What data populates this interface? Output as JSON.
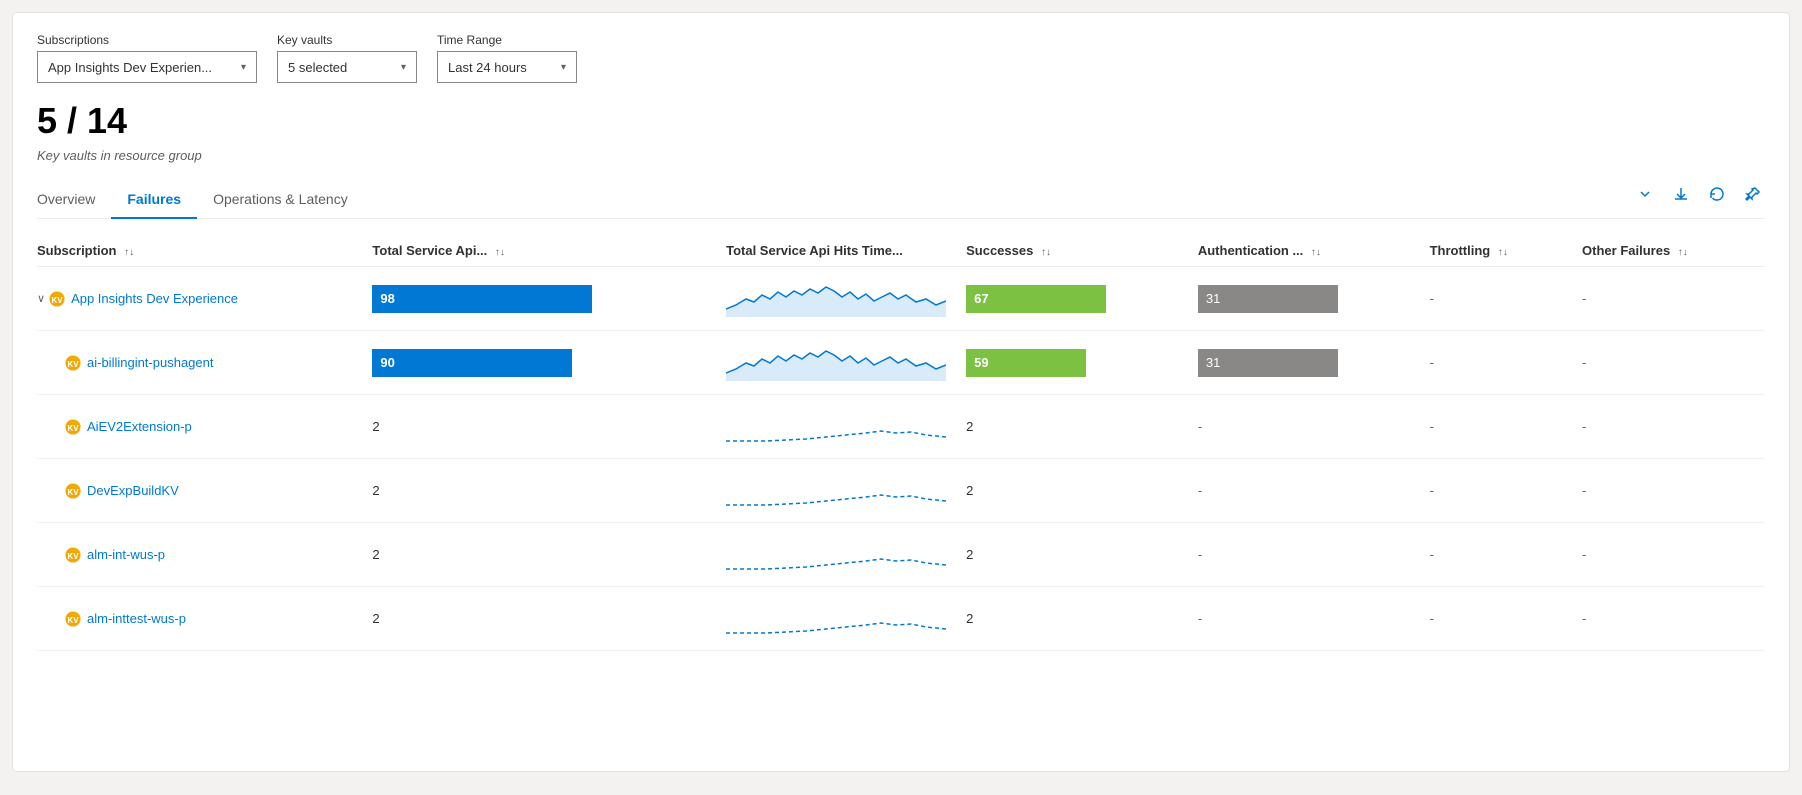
{
  "filters": {
    "subscriptions": {
      "label": "Subscriptions",
      "value": "App Insights Dev Experien..."
    },
    "keyVaults": {
      "label": "Key vaults",
      "value": "5 selected"
    },
    "timeRange": {
      "label": "Time Range",
      "value": "Last 24 hours"
    }
  },
  "summary": {
    "count": "5 / 14",
    "description": "Key vaults in resource group"
  },
  "tabs": [
    {
      "id": "overview",
      "label": "Overview"
    },
    {
      "id": "failures",
      "label": "Failures"
    },
    {
      "id": "operations-latency",
      "label": "Operations & Latency"
    }
  ],
  "activeTab": "failures",
  "tableHeaders": [
    {
      "id": "subscription",
      "label": "Subscription"
    },
    {
      "id": "total-api",
      "label": "Total Service Api..."
    },
    {
      "id": "hits-time",
      "label": "Total Service Api Hits Time..."
    },
    {
      "id": "successes",
      "label": "Successes"
    },
    {
      "id": "authentication",
      "label": "Authentication ..."
    },
    {
      "id": "throttling",
      "label": "Throttling"
    },
    {
      "id": "other-failures",
      "label": "Other Failures"
    }
  ],
  "rows": [
    {
      "type": "group",
      "name": "App Insights Dev Experience",
      "totalApi": "98",
      "totalApiBarWidth": 220,
      "successes": "67",
      "successesBarWidth": 140,
      "authentication": "31",
      "authBarWidth": 140,
      "throttling": "-",
      "otherFailures": "-",
      "hasSparkline": true,
      "sparklineType": "solid"
    },
    {
      "type": "child",
      "name": "ai-billingint-pushagent",
      "totalApi": "90",
      "totalApiBarWidth": 200,
      "successes": "59",
      "successesBarWidth": 120,
      "authentication": "31",
      "authBarWidth": 140,
      "throttling": "-",
      "otherFailures": "-",
      "hasSparkline": true,
      "sparklineType": "solid"
    },
    {
      "type": "child",
      "name": "AiEV2Extension-p",
      "totalApi": "2",
      "successes": "2",
      "authentication": "-",
      "throttling": "-",
      "otherFailures": "-",
      "hasSparkline": true,
      "sparklineType": "dotted"
    },
    {
      "type": "child",
      "name": "DevExpBuildKV",
      "totalApi": "2",
      "successes": "2",
      "authentication": "-",
      "throttling": "-",
      "otherFailures": "-",
      "hasSparkline": true,
      "sparklineType": "dotted"
    },
    {
      "type": "child",
      "name": "alm-int-wus-p",
      "totalApi": "2",
      "successes": "2",
      "authentication": "-",
      "throttling": "-",
      "otherFailures": "-",
      "hasSparkline": true,
      "sparklineType": "dotted"
    },
    {
      "type": "child",
      "name": "alm-inttest-wus-p",
      "totalApi": "2",
      "successes": "2",
      "authentication": "-",
      "throttling": "-",
      "otherFailures": "-",
      "hasSparkline": true,
      "sparklineType": "dotted"
    }
  ],
  "icons": {
    "chevronDown": "▾",
    "sortUpDown": "↑↓",
    "expand": "∨",
    "download": "↓",
    "refresh": "↺",
    "pin": "⚲"
  }
}
